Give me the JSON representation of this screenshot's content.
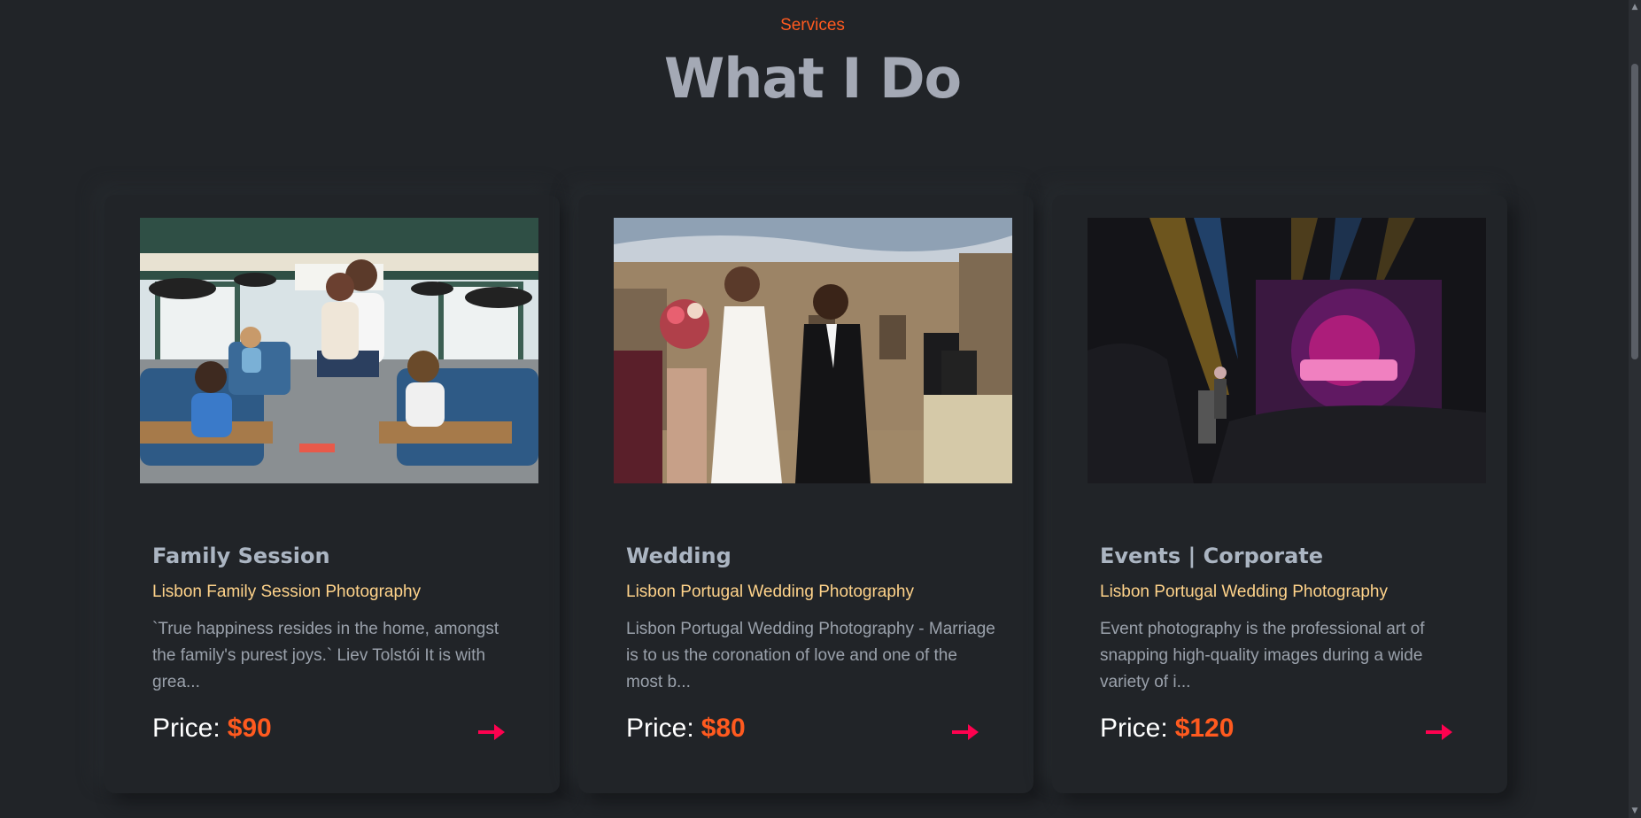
{
  "section": {
    "subtitle": "Services",
    "title": "What I Do"
  },
  "cards": [
    {
      "title": "Family Session",
      "subtitle": "Lisbon Family Session Photography",
      "description": "`True happiness resides in the home, amongst the family's purest joys.` Liev Tolstói It is with grea...",
      "price_label": "Price:",
      "price_value": "$90",
      "image": "family-bus-photo",
      "arrow_icon": "arrow-right-icon"
    },
    {
      "title": "Wedding",
      "subtitle": "Lisbon Portugal Wedding Photography",
      "description": "Lisbon Portugal Wedding Photography - Marriage is to us the coronation of love and one of the most b...",
      "price_label": "Price:",
      "price_value": "$80",
      "image": "wedding-couple-photo",
      "arrow_icon": "arrow-right-icon"
    },
    {
      "title": "Events | Corporate",
      "subtitle": "Lisbon Portugal Wedding Photography",
      "description": "Event photography is the professional art of snapping high-quality images during a wide variety of i...",
      "price_label": "Price:",
      "price_value": "$120",
      "image": "corporate-event-stage-photo",
      "arrow_icon": "arrow-right-icon"
    }
  ],
  "colors": {
    "background": "#212428",
    "accent": "#ff5a1f",
    "subtitle_gold": "#ffd38a",
    "arrow": "#ff014f",
    "heading": "#a4a9b5"
  }
}
